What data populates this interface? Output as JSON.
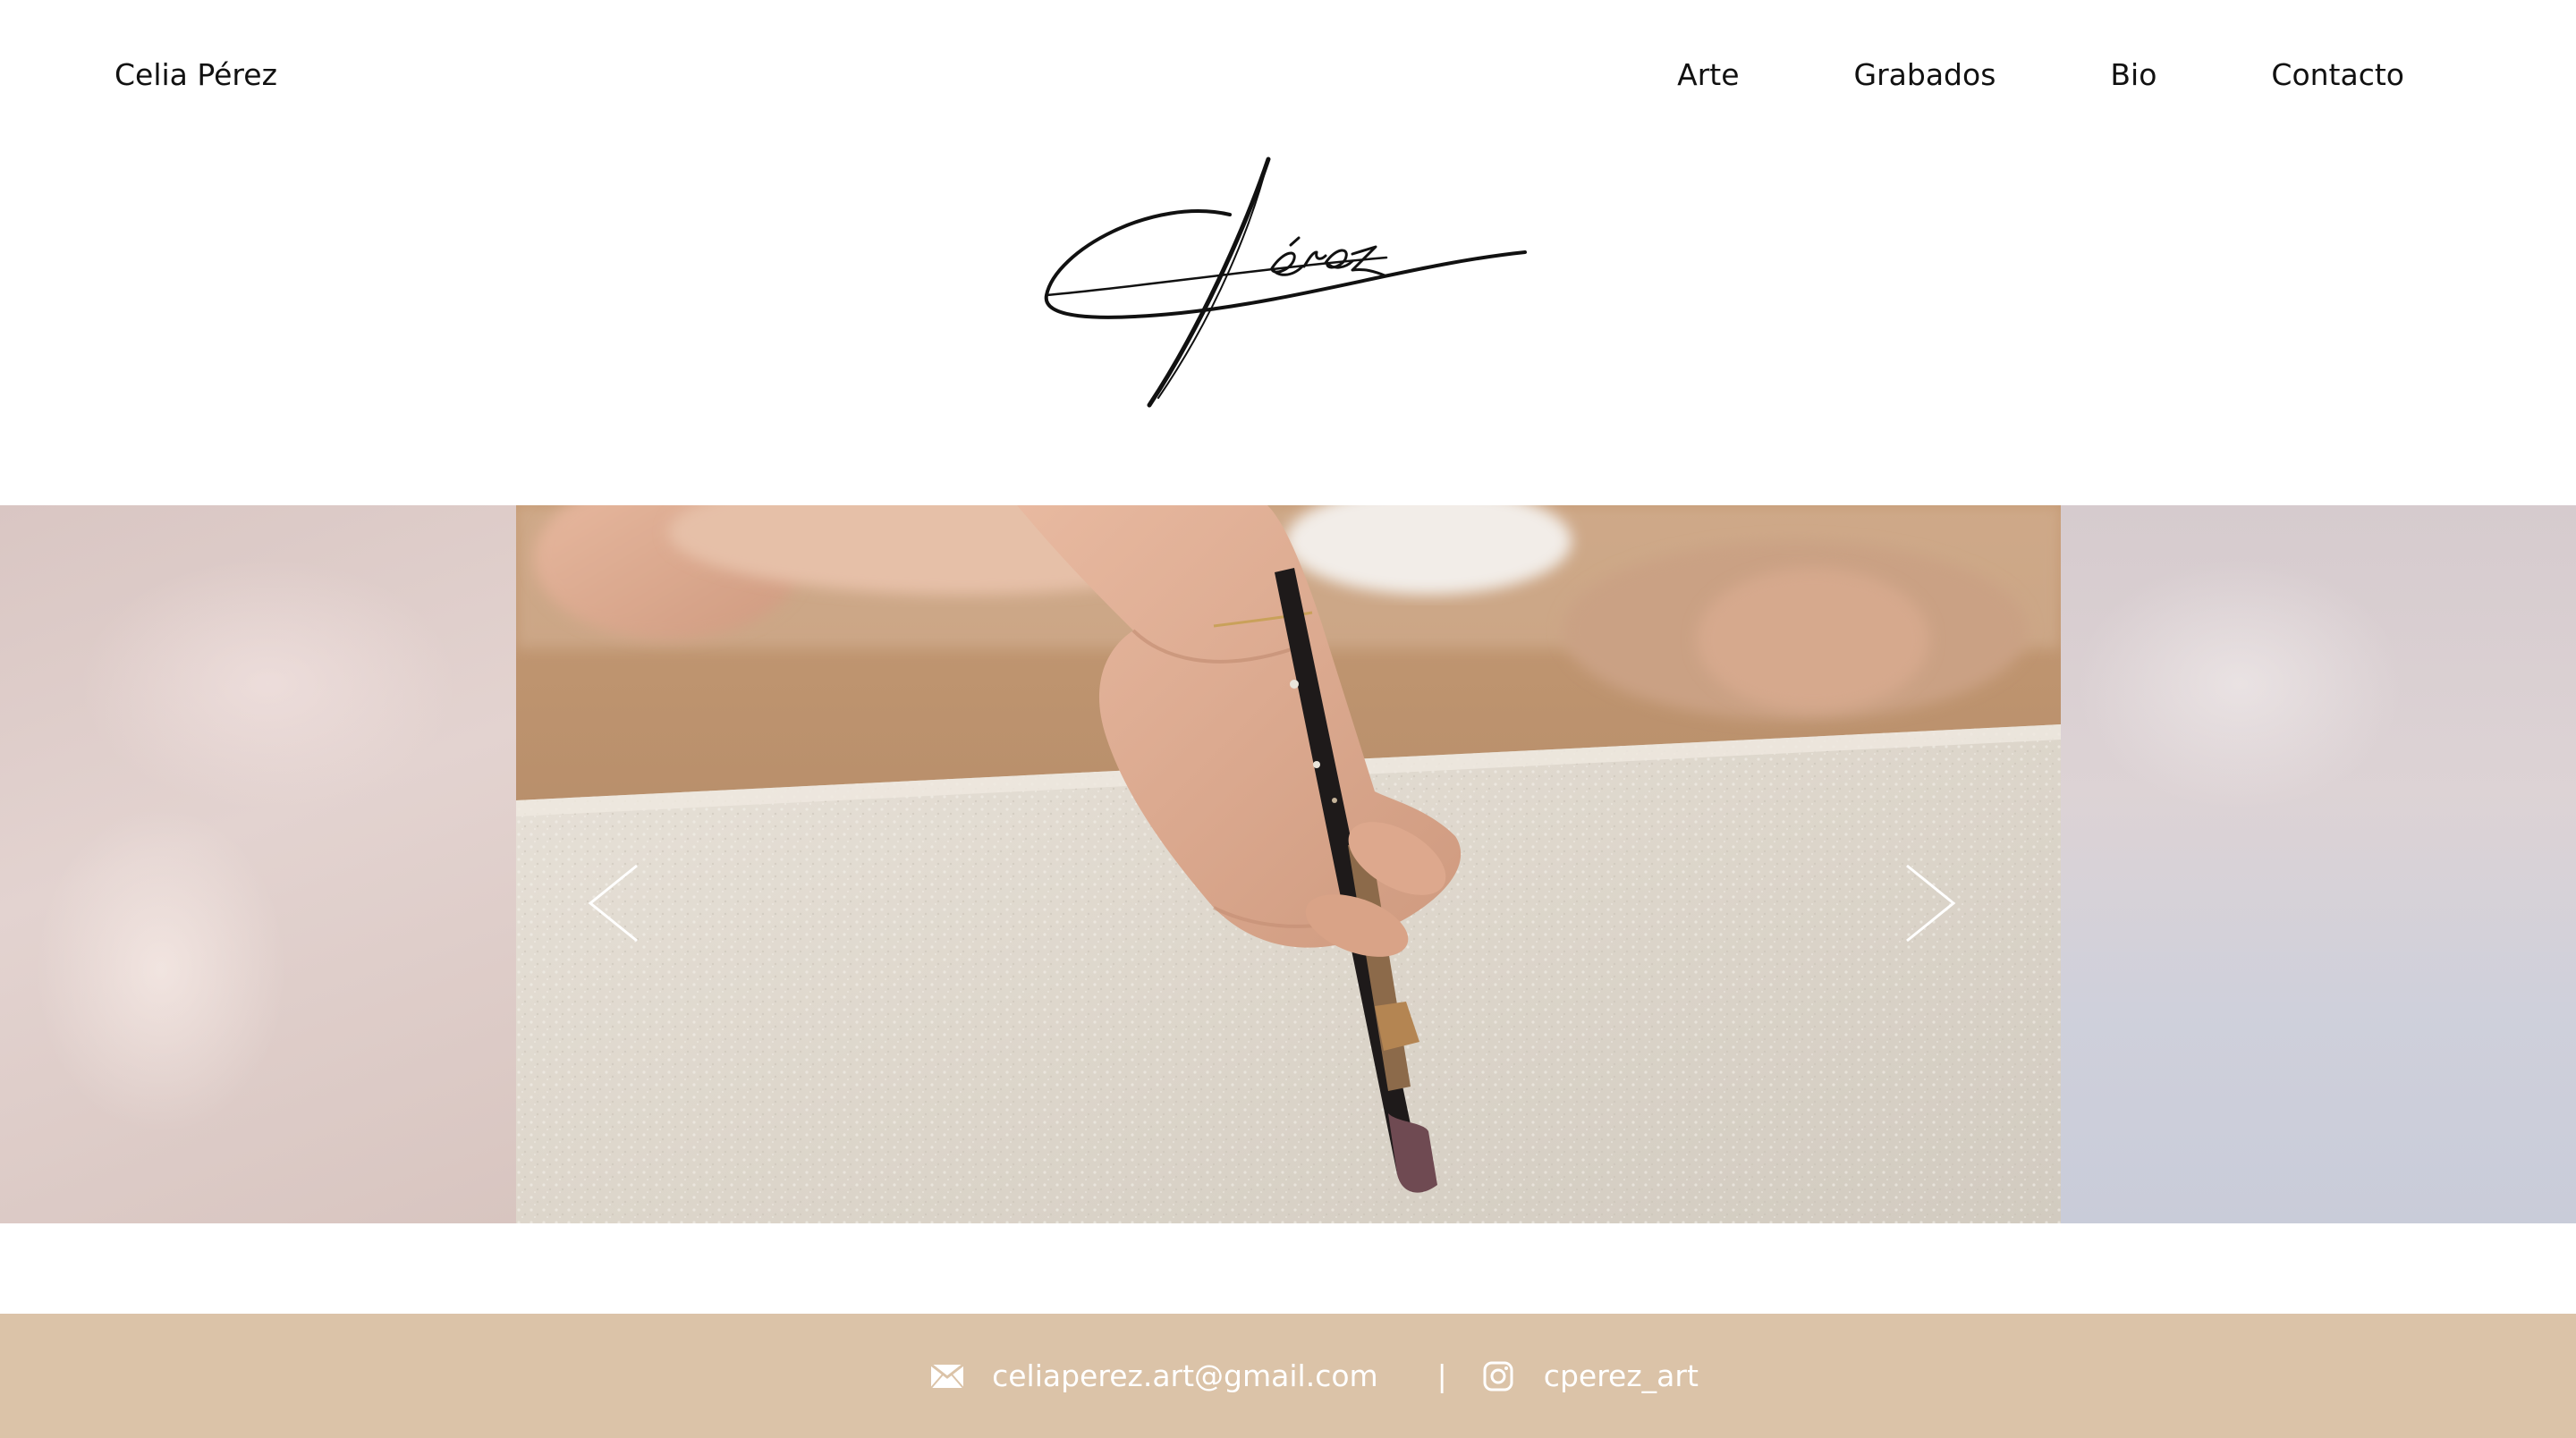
{
  "header": {
    "site_name": "Celia Pérez",
    "nav": [
      {
        "label": "Arte"
      },
      {
        "label": "Grabados"
      },
      {
        "label": "Bio"
      },
      {
        "label": "Contacto"
      }
    ]
  },
  "logo": {
    "icon": "signature-logo"
  },
  "carousel": {
    "prev_icon": "chevron-left-icon",
    "next_icon": "chevron-right-icon"
  },
  "footer": {
    "email": "celiaperez.art@gmail.com",
    "separator": "|",
    "instagram": "cperez_art"
  },
  "colors": {
    "footer_bg": "#dbc3a8",
    "text": "#111111",
    "footer_text": "#ffffff"
  }
}
